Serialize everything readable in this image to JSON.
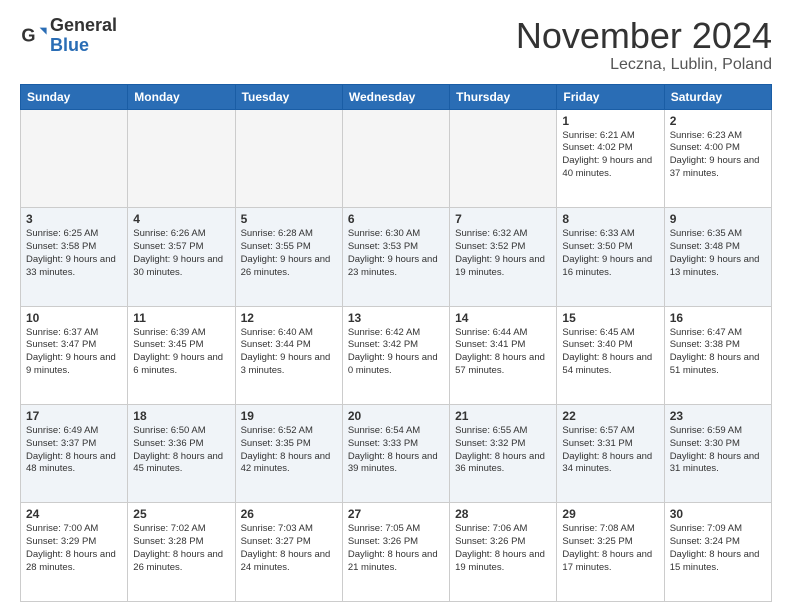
{
  "logo": {
    "general": "General",
    "blue": "Blue"
  },
  "title": "November 2024",
  "location": "Leczna, Lublin, Poland",
  "headers": [
    "Sunday",
    "Monday",
    "Tuesday",
    "Wednesday",
    "Thursday",
    "Friday",
    "Saturday"
  ],
  "weeks": [
    [
      {
        "day": "",
        "info": ""
      },
      {
        "day": "",
        "info": ""
      },
      {
        "day": "",
        "info": ""
      },
      {
        "day": "",
        "info": ""
      },
      {
        "day": "",
        "info": ""
      },
      {
        "day": "1",
        "info": "Sunrise: 6:21 AM\nSunset: 4:02 PM\nDaylight: 9 hours\nand 40 minutes."
      },
      {
        "day": "2",
        "info": "Sunrise: 6:23 AM\nSunset: 4:00 PM\nDaylight: 9 hours\nand 37 minutes."
      }
    ],
    [
      {
        "day": "3",
        "info": "Sunrise: 6:25 AM\nSunset: 3:58 PM\nDaylight: 9 hours\nand 33 minutes."
      },
      {
        "day": "4",
        "info": "Sunrise: 6:26 AM\nSunset: 3:57 PM\nDaylight: 9 hours\nand 30 minutes."
      },
      {
        "day": "5",
        "info": "Sunrise: 6:28 AM\nSunset: 3:55 PM\nDaylight: 9 hours\nand 26 minutes."
      },
      {
        "day": "6",
        "info": "Sunrise: 6:30 AM\nSunset: 3:53 PM\nDaylight: 9 hours\nand 23 minutes."
      },
      {
        "day": "7",
        "info": "Sunrise: 6:32 AM\nSunset: 3:52 PM\nDaylight: 9 hours\nand 19 minutes."
      },
      {
        "day": "8",
        "info": "Sunrise: 6:33 AM\nSunset: 3:50 PM\nDaylight: 9 hours\nand 16 minutes."
      },
      {
        "day": "9",
        "info": "Sunrise: 6:35 AM\nSunset: 3:48 PM\nDaylight: 9 hours\nand 13 minutes."
      }
    ],
    [
      {
        "day": "10",
        "info": "Sunrise: 6:37 AM\nSunset: 3:47 PM\nDaylight: 9 hours\nand 9 minutes."
      },
      {
        "day": "11",
        "info": "Sunrise: 6:39 AM\nSunset: 3:45 PM\nDaylight: 9 hours\nand 6 minutes."
      },
      {
        "day": "12",
        "info": "Sunrise: 6:40 AM\nSunset: 3:44 PM\nDaylight: 9 hours\nand 3 minutes."
      },
      {
        "day": "13",
        "info": "Sunrise: 6:42 AM\nSunset: 3:42 PM\nDaylight: 9 hours\nand 0 minutes."
      },
      {
        "day": "14",
        "info": "Sunrise: 6:44 AM\nSunset: 3:41 PM\nDaylight: 8 hours\nand 57 minutes."
      },
      {
        "day": "15",
        "info": "Sunrise: 6:45 AM\nSunset: 3:40 PM\nDaylight: 8 hours\nand 54 minutes."
      },
      {
        "day": "16",
        "info": "Sunrise: 6:47 AM\nSunset: 3:38 PM\nDaylight: 8 hours\nand 51 minutes."
      }
    ],
    [
      {
        "day": "17",
        "info": "Sunrise: 6:49 AM\nSunset: 3:37 PM\nDaylight: 8 hours\nand 48 minutes."
      },
      {
        "day": "18",
        "info": "Sunrise: 6:50 AM\nSunset: 3:36 PM\nDaylight: 8 hours\nand 45 minutes."
      },
      {
        "day": "19",
        "info": "Sunrise: 6:52 AM\nSunset: 3:35 PM\nDaylight: 8 hours\nand 42 minutes."
      },
      {
        "day": "20",
        "info": "Sunrise: 6:54 AM\nSunset: 3:33 PM\nDaylight: 8 hours\nand 39 minutes."
      },
      {
        "day": "21",
        "info": "Sunrise: 6:55 AM\nSunset: 3:32 PM\nDaylight: 8 hours\nand 36 minutes."
      },
      {
        "day": "22",
        "info": "Sunrise: 6:57 AM\nSunset: 3:31 PM\nDaylight: 8 hours\nand 34 minutes."
      },
      {
        "day": "23",
        "info": "Sunrise: 6:59 AM\nSunset: 3:30 PM\nDaylight: 8 hours\nand 31 minutes."
      }
    ],
    [
      {
        "day": "24",
        "info": "Sunrise: 7:00 AM\nSunset: 3:29 PM\nDaylight: 8 hours\nand 28 minutes."
      },
      {
        "day": "25",
        "info": "Sunrise: 7:02 AM\nSunset: 3:28 PM\nDaylight: 8 hours\nand 26 minutes."
      },
      {
        "day": "26",
        "info": "Sunrise: 7:03 AM\nSunset: 3:27 PM\nDaylight: 8 hours\nand 24 minutes."
      },
      {
        "day": "27",
        "info": "Sunrise: 7:05 AM\nSunset: 3:26 PM\nDaylight: 8 hours\nand 21 minutes."
      },
      {
        "day": "28",
        "info": "Sunrise: 7:06 AM\nSunset: 3:26 PM\nDaylight: 8 hours\nand 19 minutes."
      },
      {
        "day": "29",
        "info": "Sunrise: 7:08 AM\nSunset: 3:25 PM\nDaylight: 8 hours\nand 17 minutes."
      },
      {
        "day": "30",
        "info": "Sunrise: 7:09 AM\nSunset: 3:24 PM\nDaylight: 8 hours\nand 15 minutes."
      }
    ]
  ]
}
